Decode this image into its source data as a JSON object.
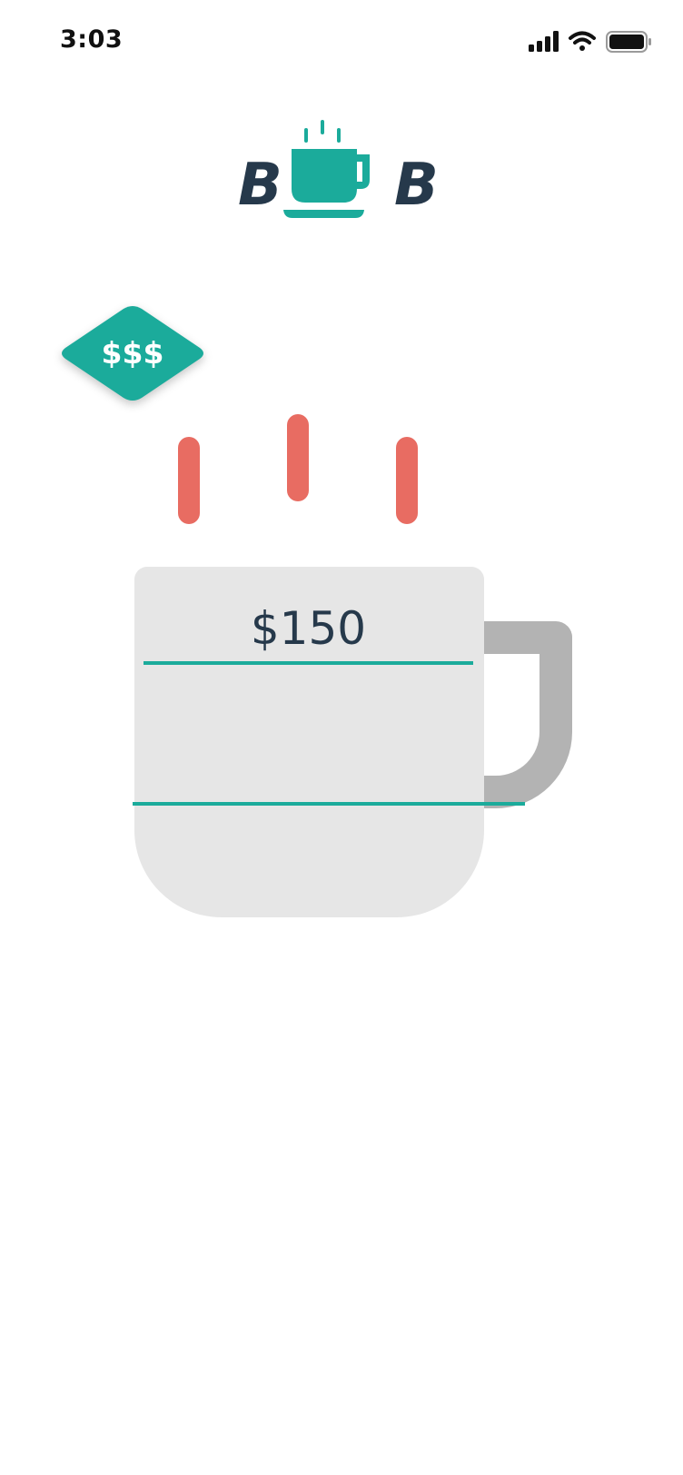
{
  "status_bar": {
    "time": "3:03",
    "icons": [
      "cellular-signal-icon",
      "wifi-icon",
      "battery-icon"
    ]
  },
  "logo": {
    "left_letter": "B",
    "right_letter": "B",
    "icon": "coffee-cup-icon"
  },
  "price_tier": {
    "label": "$$$"
  },
  "mug": {
    "amount": "$150",
    "icons": [
      "steam-icon",
      "mug-handle-icon"
    ]
  },
  "colors": {
    "accent": "#1bab9b",
    "dark_text": "#26394b",
    "steam": "#e86c62",
    "mug_body": "#e6e6e6",
    "mug_handle": "#b3b3b3"
  }
}
